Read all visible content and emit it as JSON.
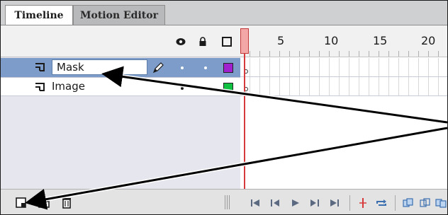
{
  "tabs": {
    "timeline": "Timeline",
    "motion_editor": "Motion Editor"
  },
  "header": {
    "frame_numbers": [
      "l",
      "5",
      "10",
      "15",
      "20"
    ]
  },
  "layers": [
    {
      "name": "Mask",
      "selected": true,
      "editing": true,
      "color": "#a020d0"
    },
    {
      "name": "Image",
      "selected": false,
      "editing": false,
      "color": "#10c040"
    }
  ],
  "icons": {
    "eye": "eye-icon",
    "lock": "lock-icon",
    "outline": "outline-icon",
    "new_layer": "new-layer-icon",
    "new_folder": "new-folder-icon",
    "delete": "trash-icon"
  },
  "colors": {
    "selection": "#7d9cc9",
    "playhead": "#d63a3a",
    "accent": "#3b6fb0"
  }
}
